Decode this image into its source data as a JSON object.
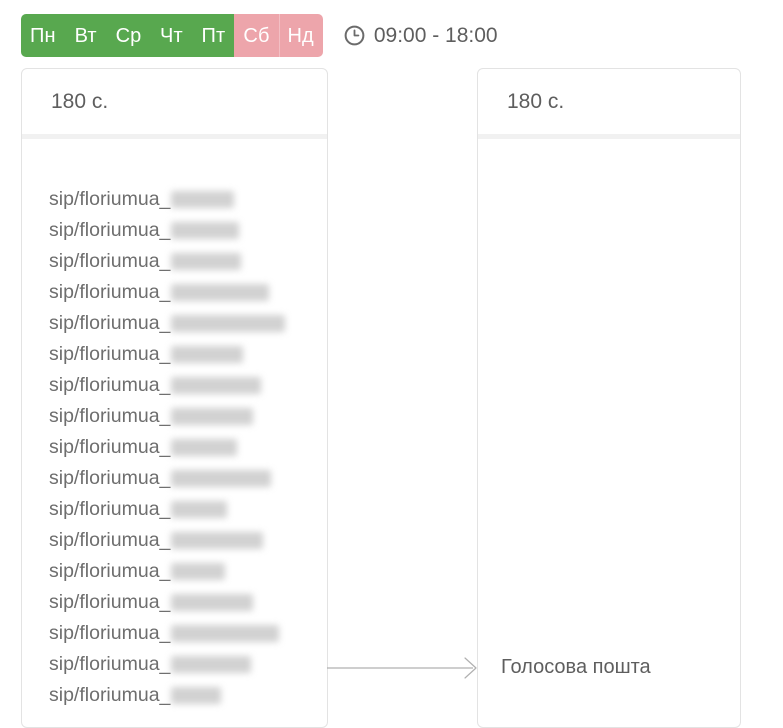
{
  "schedule": {
    "days": [
      {
        "label": "Пн",
        "state": "work"
      },
      {
        "label": "Вт",
        "state": "work"
      },
      {
        "label": "Ср",
        "state": "work"
      },
      {
        "label": "Чт",
        "state": "work"
      },
      {
        "label": "Пт",
        "state": "work"
      },
      {
        "label": "Сб",
        "state": "off"
      },
      {
        "label": "Нд",
        "state": "off"
      }
    ],
    "clock_icon": "clock-icon",
    "work_time": "09:00 - 18:00",
    "colors": {
      "work_day": "#58a84f",
      "off_day": "#eda5ab",
      "text": "#5e5e5e"
    }
  },
  "cards": {
    "sip_group": {
      "header_title": "180 с.",
      "rows": [
        {
          "prefix": "sip/floriumua_",
          "suffix_redacted": true,
          "redacted_width": 63
        },
        {
          "prefix": "sip/floriumua_",
          "suffix_redacted": true,
          "redacted_width": 68
        },
        {
          "prefix": "sip/floriumua_",
          "suffix_redacted": true,
          "redacted_width": 70
        },
        {
          "prefix": "sip/floriumua_",
          "suffix_redacted": true,
          "redacted_width": 98
        },
        {
          "prefix": "sip/floriumua_",
          "suffix_redacted": true,
          "redacted_width": 114
        },
        {
          "prefix": "sip/floriumua_",
          "suffix_redacted": true,
          "redacted_width": 72
        },
        {
          "prefix": "sip/floriumua_",
          "suffix_redacted": true,
          "redacted_width": 90
        },
        {
          "prefix": "sip/floriumua_",
          "suffix_redacted": true,
          "redacted_width": 82
        },
        {
          "prefix": "sip/floriumua_",
          "suffix_redacted": true,
          "redacted_width": 66
        },
        {
          "prefix": "sip/floriumua_",
          "suffix_redacted": true,
          "redacted_width": 100
        },
        {
          "prefix": "sip/floriumua_",
          "suffix_redacted": true,
          "redacted_width": 56
        },
        {
          "prefix": "sip/floriumua_",
          "suffix_redacted": true,
          "redacted_width": 92
        },
        {
          "prefix": "sip/floriumua_",
          "suffix_redacted": true,
          "redacted_width": 54
        },
        {
          "prefix": "sip/floriumua_",
          "suffix_redacted": true,
          "redacted_width": 82
        },
        {
          "prefix": "sip/floriumua_",
          "suffix_redacted": true,
          "redacted_width": 108
        },
        {
          "prefix": "sip/floriumua_",
          "suffix_redacted": true,
          "redacted_width": 80
        },
        {
          "prefix": "sip/floriumua_",
          "suffix_redacted": true,
          "redacted_width": 50
        }
      ]
    },
    "voicemail": {
      "header_title": "180 с.",
      "label": "Голосова пошта"
    }
  },
  "connector": {
    "name": "arrow-right",
    "color": "#b0b0b0"
  }
}
